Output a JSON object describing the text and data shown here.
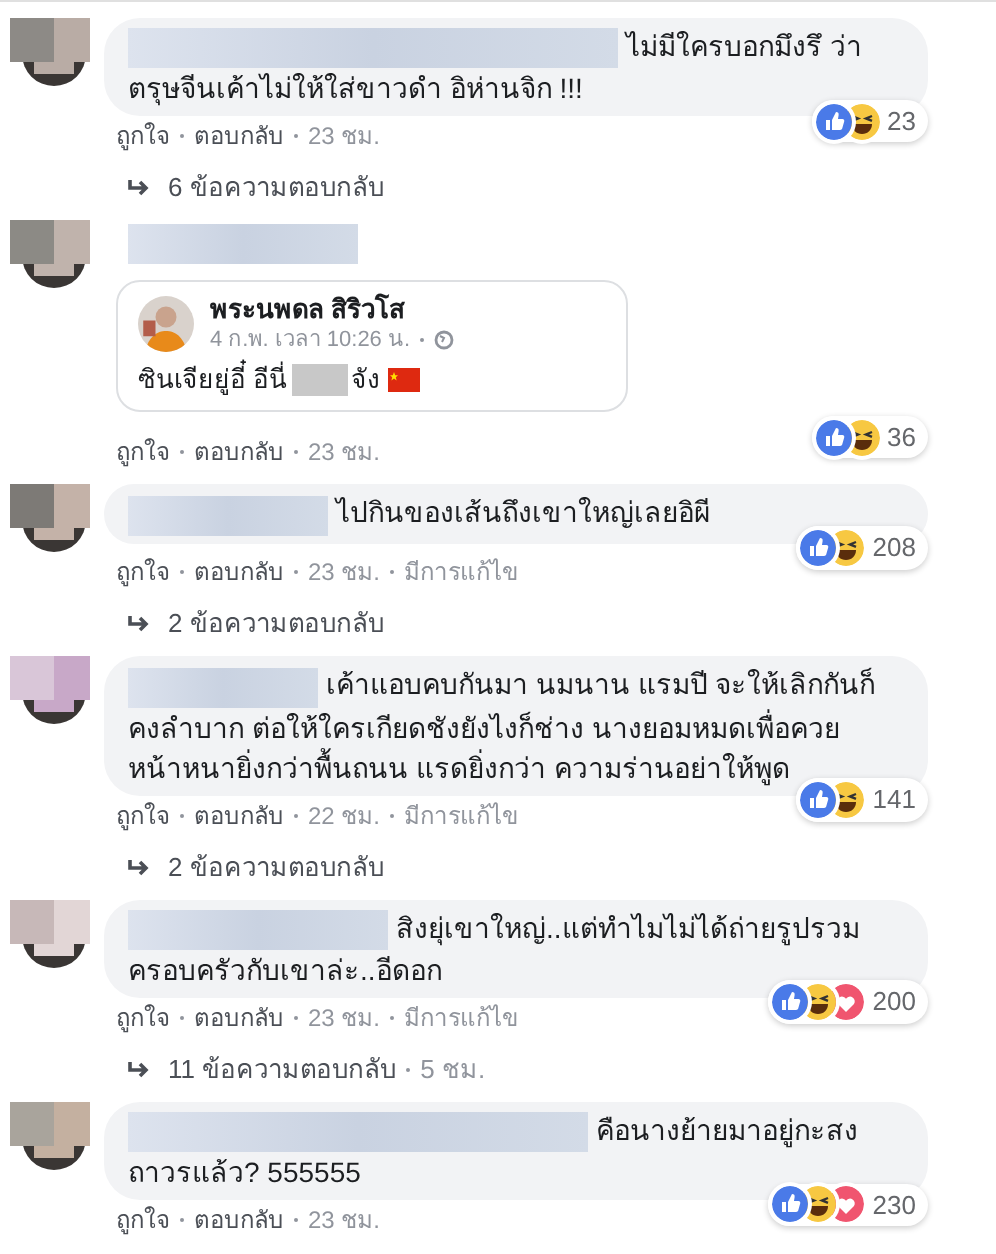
{
  "comments": [
    {
      "text": "ไม่มีใครบอกมึงรึ ว่า ตรุษจีนเค้าไม่ให้ใส่ขาวดำ อิห่านจิก !!!",
      "reactions": {
        "like": true,
        "haha": true,
        "love": false,
        "count": "23"
      },
      "actions": [
        "ถูกใจ",
        "ตอบกลับ",
        "23 ชม."
      ],
      "replies": {
        "label": "6 ข้อความตอบกลับ"
      }
    },
    {
      "embed": {
        "author": "พระนพดล สิริวโส",
        "time": "4 ก.พ. เวลา 10:26 น.",
        "text_parts": [
          "ซินเจียยู่อี๋ อีนี่",
          "จัง"
        ]
      },
      "reactions": {
        "like": true,
        "haha": true,
        "love": false,
        "count": "36"
      },
      "actions": [
        "ถูกใจ",
        "ตอบกลับ",
        "23 ชม."
      ]
    },
    {
      "text": "ไปกินของเส้นถึงเขาใหญ่เลยอิผี",
      "reactions": {
        "like": true,
        "haha": true,
        "love": false,
        "count": "208"
      },
      "actions": [
        "ถูกใจ",
        "ตอบกลับ",
        "23 ชม.",
        "มีการแก้ไข"
      ],
      "replies": {
        "label": "2 ข้อความตอบกลับ"
      }
    },
    {
      "text": "เค้าแอบคบกันมา นมนาน แรมปี จะให้เลิกกันก็คงลำบาก ต่อให้ใครเกียดชังยังไงก็ช่าง นางยอมหมดเพื่อควย หน้าหนายิ่งกว่าพื้นถนน แรดยิ่งกว่า ความร่านอย่าให้พูด",
      "reactions": {
        "like": true,
        "haha": true,
        "love": false,
        "count": "141"
      },
      "actions": [
        "ถูกใจ",
        "ตอบกลับ",
        "22 ชม.",
        "มีการแก้ไข"
      ],
      "replies": {
        "label": "2 ข้อความตอบกลับ"
      }
    },
    {
      "text": "สิงยุ่เขาใหญ่..แต่ทำไมไม่ได้ถ่ายรูปรวมครอบครัวกับเขาล่ะ..อีดอก",
      "reactions": {
        "like": true,
        "haha": true,
        "love": true,
        "count": "200"
      },
      "actions": [
        "ถูกใจ",
        "ตอบกลับ",
        "23 ชม.",
        "มีการแก้ไข"
      ],
      "replies": {
        "label": "11 ข้อความตอบกลับ",
        "time": "5 ชม."
      }
    },
    {
      "text": "คือนางย้ายมาอยู่กะสงถาวรแล้ว? 555555",
      "reactions": {
        "like": true,
        "haha": true,
        "love": true,
        "count": "230"
      },
      "actions": [
        "ถูกใจ",
        "ตอบกลับ",
        "23 ชม."
      ]
    }
  ]
}
